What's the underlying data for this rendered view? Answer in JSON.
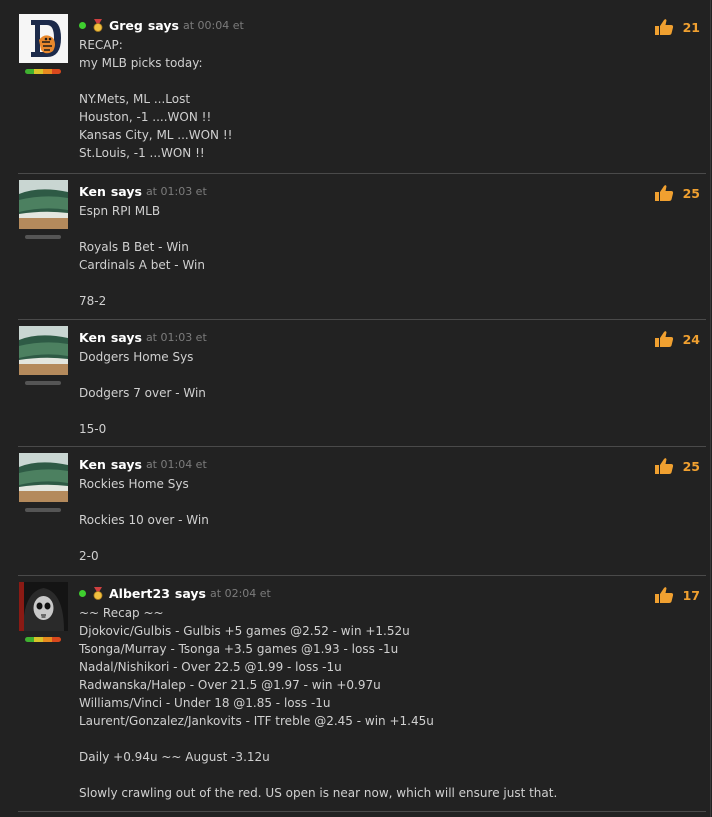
{
  "posts": [
    {
      "author": "Greg",
      "says": "says",
      "time": "at 00:04 et",
      "likes": "21",
      "online": true,
      "medal": true,
      "avatar": "tigers-logo-icon",
      "rep": "color",
      "text": "RECAP:\nmy MLB picks today:\n\nNY.Mets, ML ...Lost\nHouston, -1 ....WON !!\nKansas City, ML ...WON !!\nSt.Louis, -1 ...WON !!"
    },
    {
      "author": "Ken",
      "says": "says",
      "time": "at 01:03 et",
      "likes": "25",
      "online": false,
      "medal": false,
      "avatar": "wave-photo-icon",
      "rep": "gray",
      "text": "Espn RPI MLB\n\nRoyals B Bet - Win\nCardinals A bet - Win\n\n78-2"
    },
    {
      "author": "Ken",
      "says": "says",
      "time": "at 01:03 et",
      "likes": "24",
      "online": false,
      "medal": false,
      "avatar": "wave-photo-icon",
      "rep": "gray",
      "text": "Dodgers Home Sys\n\nDodgers 7 over - Win\n\n15-0"
    },
    {
      "author": "Ken",
      "says": "says",
      "time": "at 01:04 et",
      "likes": "25",
      "online": false,
      "medal": false,
      "avatar": "wave-photo-icon",
      "rep": "gray",
      "text": "Rockies Home Sys\n\nRockies 10 over - Win\n\n2-0"
    },
    {
      "author": "Albert23",
      "says": "says",
      "time": "at 02:04 et",
      "likes": "17",
      "online": true,
      "medal": true,
      "avatar": "hooded-skull-icon",
      "rep": "color",
      "text": "~~ Recap ~~\nDjokovic/Gulbis - Gulbis +5 games @2.52 - win +1.52u\nTsonga/Murray - Tsonga +3.5 games @1.93 - loss -1u\nNadal/Nishikori - Over 22.5 @1.99 - loss -1u\nRadwanska/Halep - Over 21.5 @1.97 - win +0.97u\nWilliams/Vinci - Under 18 @1.85 - loss -1u\nLaurent/Gonzalez/Jankovits - ITF treble @2.45 - win +1.45u\n\nDaily +0.94u ~~ August -3.12u\n\nSlowly crawling out of the red. US open is near now, which will ensure just that."
    }
  ],
  "colors": {
    "background": "#222222",
    "author": "#ffffff",
    "timestamp": "#7c7c7c",
    "likes": "#f0a030",
    "online": "#3fcf2f"
  }
}
